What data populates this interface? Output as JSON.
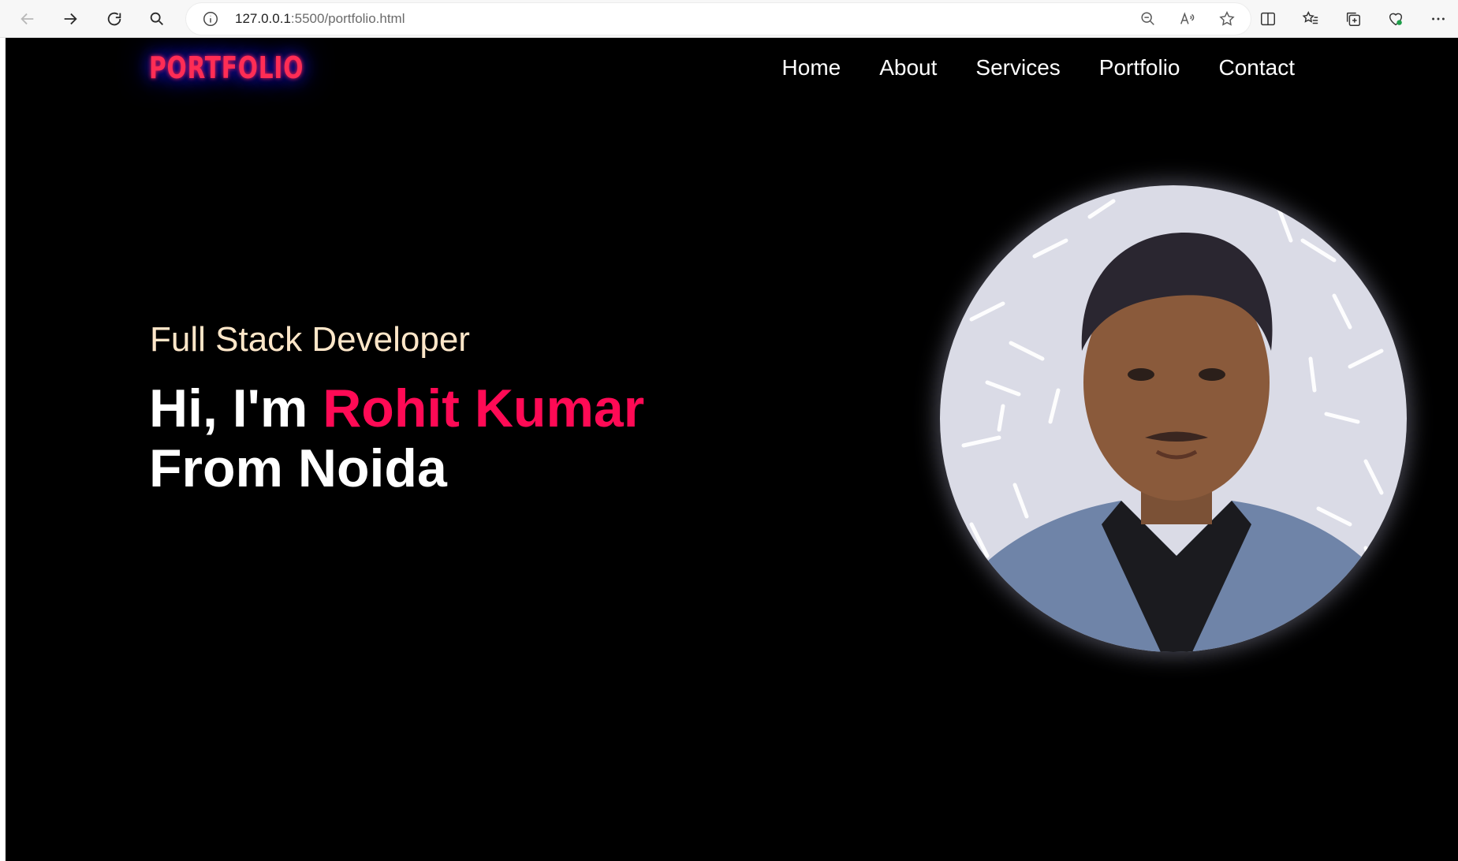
{
  "browser": {
    "url_host": "127.0.0.1",
    "url_path": ":5500/portfolio.html",
    "icons": [
      "back-icon",
      "forward-icon",
      "refresh-icon",
      "search-icon",
      "info-icon",
      "zoom-out-icon",
      "read-aloud-icon",
      "favorite-star-icon",
      "split-screen-icon",
      "favorites-icon",
      "collections-icon",
      "browser-essentials-icon",
      "more-icon"
    ]
  },
  "site": {
    "logo": "PORTFOLIO",
    "nav": [
      "Home",
      "About",
      "Services",
      "Portfolio",
      "Contact"
    ],
    "hero": {
      "subtitle": "Full Stack Developer",
      "greeting": "Hi, I'm ",
      "name": "Rohit Kumar",
      "line2": "From Noida"
    },
    "colors": {
      "background": "#000000",
      "accent": "#ff0a55",
      "subtitle": "#ffe7c9",
      "logo_glow": "#1b1bff"
    }
  }
}
